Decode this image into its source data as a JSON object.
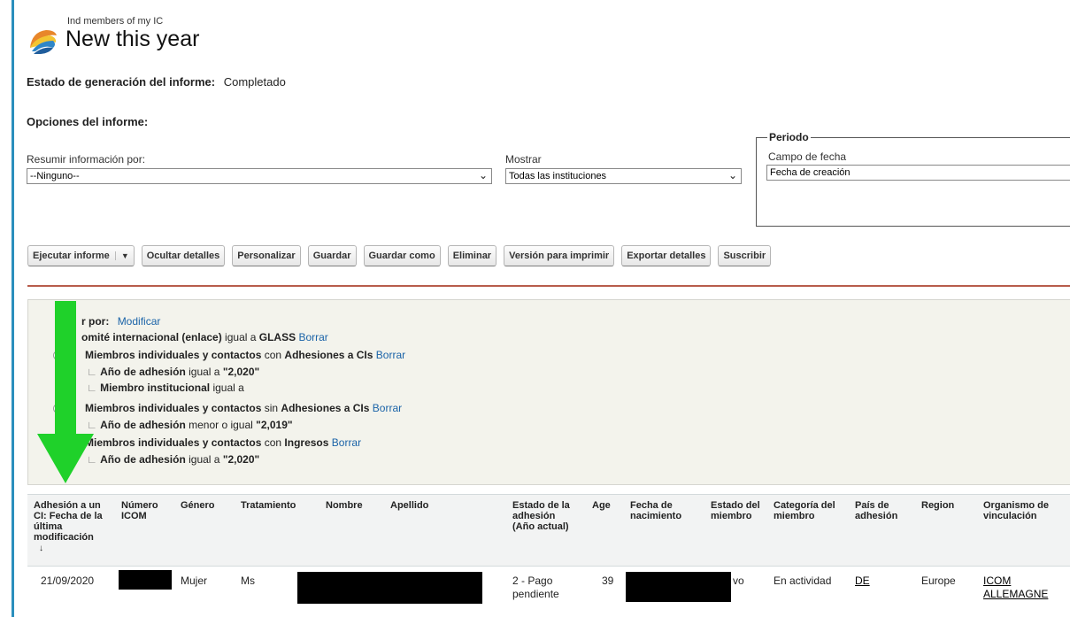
{
  "header": {
    "subtitle": "Ind members of my IC",
    "title": "New this year"
  },
  "status": {
    "label": "Estado de generación del informe:",
    "value": "Completado"
  },
  "options": {
    "heading": "Opciones del informe:",
    "summarize_label": "Resumir información por:",
    "summarize_value": "--Ninguno--",
    "show_label": "Mostrar",
    "show_value": "Todas las instituciones",
    "period_legend": "Periodo",
    "date_field_label": "Campo de fecha",
    "date_field_value": "Fecha de creación"
  },
  "toolbar": {
    "run": "Ejecutar informe",
    "hide": "Ocultar detalles",
    "customize": "Personalizar",
    "save": "Guardar",
    "save_as": "Guardar como",
    "delete": "Eliminar",
    "print": "Versión para imprimir",
    "export": "Exportar detalles",
    "subscribe": "Suscribir"
  },
  "filters": {
    "prefix": "r por:",
    "modify": "Modificar",
    "remove": "Borrar",
    "f1": {
      "field": "omité internacional (enlace)",
      "op": " igual a ",
      "val": "GLASS"
    },
    "f2": {
      "field": "Miembros individuales y contactos",
      "op": " con ",
      "val": "Adhesiones a CIs"
    },
    "f2a": {
      "field": "Año de adhesión",
      "op": " igual a ",
      "val": "\"2,020\""
    },
    "f2b": {
      "field": "Miembro institucional",
      "op": " igual a"
    },
    "f3": {
      "field": "Miembros individuales y contactos",
      "op": " sin ",
      "val": "Adhesiones a CIs"
    },
    "f3a": {
      "field": "Año de adhesión",
      "op": " menor o igual ",
      "val": "\"2,019\""
    },
    "f4": {
      "field": "Miembros individuales y contactos",
      "op": " con ",
      "val": "Ingresos"
    },
    "f4a": {
      "field": "Año de adhesión",
      "op": " igual a ",
      "val": "\"2,020\""
    }
  },
  "table": {
    "headers": {
      "adhesion": "Adhesión a un CI: Fecha de la última modificación",
      "sort": "↓",
      "numero": "Número ICOM",
      "genero": "Género",
      "tratamiento": "Tratamiento",
      "nombre": "Nombre",
      "apellido": "Apellido",
      "estado_adh": "Estado de la adhesión (Año actual)",
      "age": "Age",
      "fecha_nac": "Fecha de nacimiento",
      "estado_mbr": "Estado del miembro",
      "categoria": "Categoría del miembro",
      "pais": "País de adhesión",
      "region": "Region",
      "organismo": "Organismo de vinculación"
    },
    "row": {
      "fecha": "21/09/2020",
      "genero": "Mujer",
      "tratamiento": "Ms",
      "estado_adh": "2 - Pago pendiente",
      "age": "39",
      "estado_mbr": "vo",
      "categoria": "En actividad",
      "pais": "DE",
      "region": "Europe",
      "organismo": "ICOM ALLEMAGNE"
    }
  },
  "colors": {
    "arrow": "#1fd12a",
    "accent_bar": "#2a8fbd",
    "rule": "#b85c4c"
  }
}
